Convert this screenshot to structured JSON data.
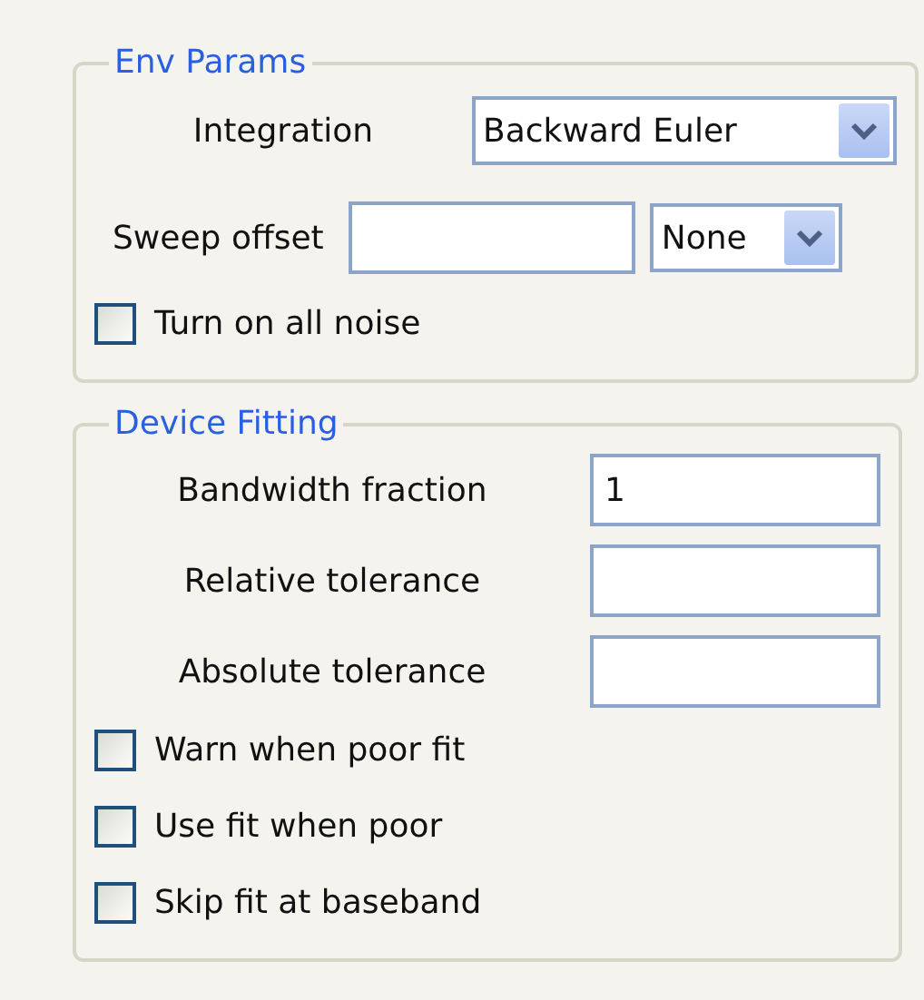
{
  "env_params": {
    "title": "Env Params",
    "integration": {
      "label": "Integration",
      "value": "Backward Euler"
    },
    "sweep_offset": {
      "label": "Sweep offset",
      "unit": "None"
    },
    "checkboxes": [
      {
        "label": "Turn on all noise",
        "checked": false
      }
    ]
  },
  "device_fitting": {
    "title": "Device Fitting",
    "fields": [
      {
        "label": "Bandwidth fraction",
        "value": "1"
      },
      {
        "label": "Relative tolerance"
      },
      {
        "label": "Absolute tolerance"
      }
    ],
    "checkboxes": [
      {
        "label": "Warn when poor fit",
        "checked": false
      },
      {
        "label": "Use fit when poor",
        "checked": false
      },
      {
        "label": "Skip fit at baseband",
        "checked": false
      }
    ]
  }
}
